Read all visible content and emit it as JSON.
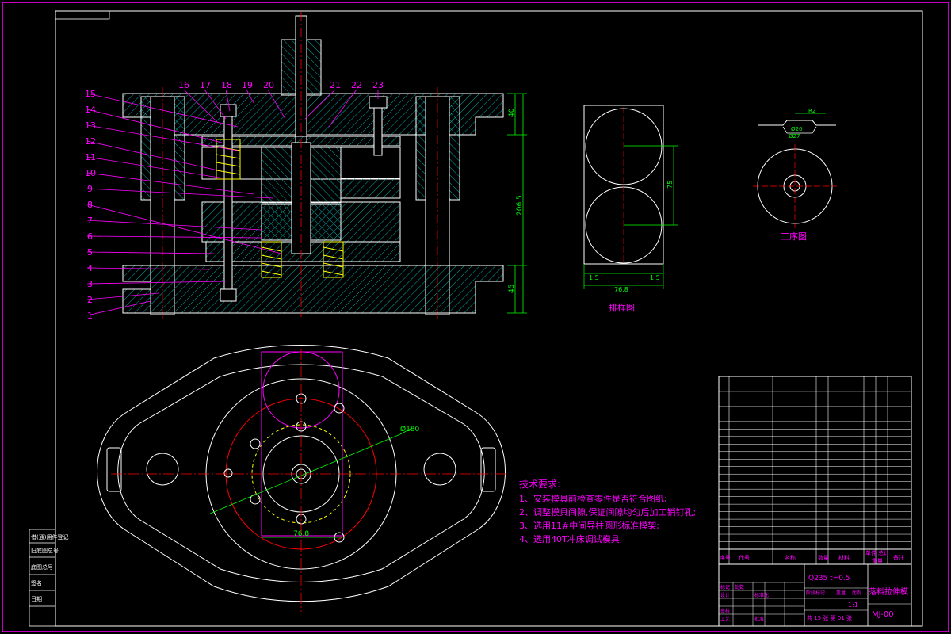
{
  "colors": {
    "background": "#000000",
    "frame": "#ff00ff",
    "outline": "#ffffff",
    "centerline": "#ff0000",
    "hatch": "#00aaaa",
    "dimension": "#00ff00",
    "spring": "#ffff00"
  },
  "section_view": {
    "part_numbers": [
      "1",
      "2",
      "3",
      "4",
      "5",
      "6",
      "7",
      "8",
      "9",
      "10",
      "11",
      "12",
      "13",
      "14",
      "15",
      "16",
      "17",
      "18",
      "19",
      "20",
      "21",
      "22",
      "23"
    ],
    "dimensions": {
      "top_height": "40",
      "total_height": "206.5",
      "bottom_height": "45"
    }
  },
  "layout_view": {
    "caption": "排样图",
    "dim_left": "1.5",
    "dim_right": "1.5",
    "dim_width": "76.8",
    "dim_pitch": "75"
  },
  "process_view": {
    "caption": "工序图",
    "dim_top": "R2",
    "dim_inner": "Ø20",
    "dim_outer": "Ø27"
  },
  "plan_view": {
    "dim_diameter": "Ø180",
    "dim_width": "76.8"
  },
  "technical_requirements": {
    "title": "技术要求:",
    "items": [
      "1、安装模具前检查零件是否符合图纸;",
      "2、调整模具间隙,保证间隙均匀后加工销钉孔;",
      "3、选用11#中间导柱圆形标准模架;",
      "4、选用40T冲床调试模具;"
    ]
  },
  "title_block": {
    "material_line": "Q235 t=0.5",
    "part_name": "落料拉伸模",
    "drawing_number": "MJ-00",
    "scale": "1:1",
    "sheet_info": "共 15 张   第 01 张",
    "header_cols": [
      "序号",
      "代号",
      "名称",
      "数量",
      "材料",
      "单件",
      "总计",
      "重量",
      "备注"
    ],
    "role_labels": [
      "设计",
      "审核",
      "工艺",
      "标记",
      "处数",
      "分区",
      "更改文件号",
      "签名",
      "年月日",
      "标准化",
      "批准",
      "阶段标记",
      "重量",
      "比例"
    ]
  },
  "side_stamp": {
    "labels": [
      "借(通)用件登记",
      "旧底图总号",
      "底图总号",
      "签名",
      "日期"
    ]
  }
}
